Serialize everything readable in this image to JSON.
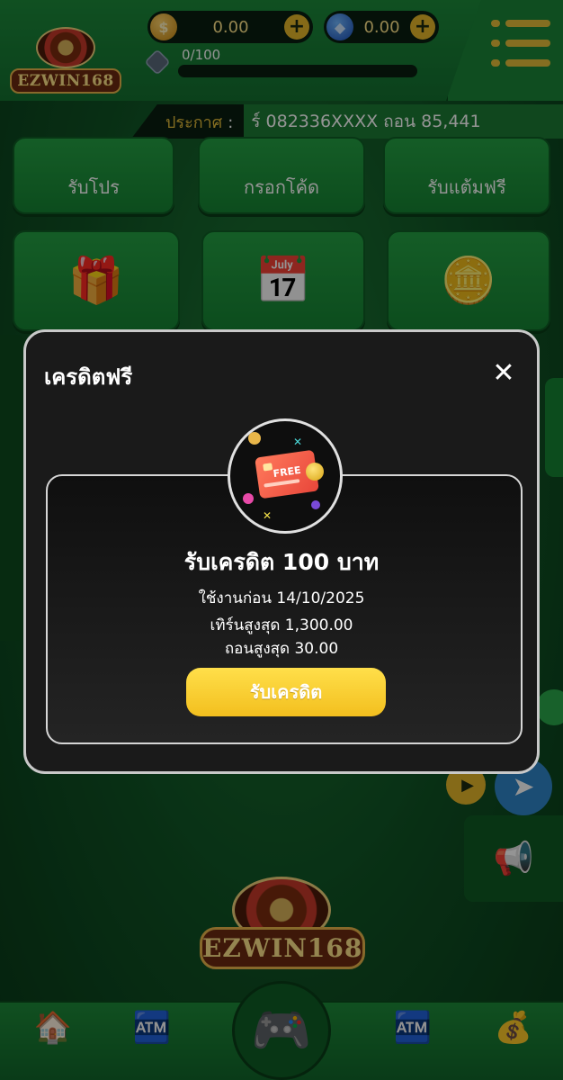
{
  "header": {
    "logo_text": "EZWIN168",
    "coin_balance": "0.00",
    "gem_balance": "0.00",
    "level_progress": "0/100",
    "coin_plus": "+",
    "gem_plus": "+"
  },
  "announcement": {
    "label": "ประกาศ",
    "colon": ":",
    "text": "ร์ 082336XXXX ถอน 85,441"
  },
  "tiles": {
    "row1": [
      {
        "label": "รับโปร"
      },
      {
        "label": "กรอกโค้ด"
      },
      {
        "label": "รับแต้มฟรี"
      }
    ]
  },
  "modal": {
    "title": "เครดิตฟรี",
    "close_symbol": "✕",
    "badge_text": "FREE",
    "credit_title": "รับเครดิต 100 บาท",
    "use_before": "ใช้งานก่อน 14/10/2025",
    "max_turn": "เทิร์นสูงสุด 1,300.00",
    "max_withdraw": "ถอนสูงสุด 30.00",
    "claim_button": "รับเครดิต"
  },
  "footer": {
    "logo_text": "EZWIN168"
  },
  "colors": {
    "accent_gold": "#e6be3a",
    "button_yellow": "#f3bf1e",
    "app_green": "#168433",
    "modal_bg": "#1a1a1a"
  },
  "icons": [
    "coin-icon",
    "gem-icon",
    "level-icon",
    "menu-icon",
    "close-icon",
    "play-icon",
    "telegram-icon",
    "megaphone-icon",
    "home-icon",
    "deposit-icon",
    "gamepad-icon",
    "withdraw-icon",
    "cashback-icon"
  ]
}
